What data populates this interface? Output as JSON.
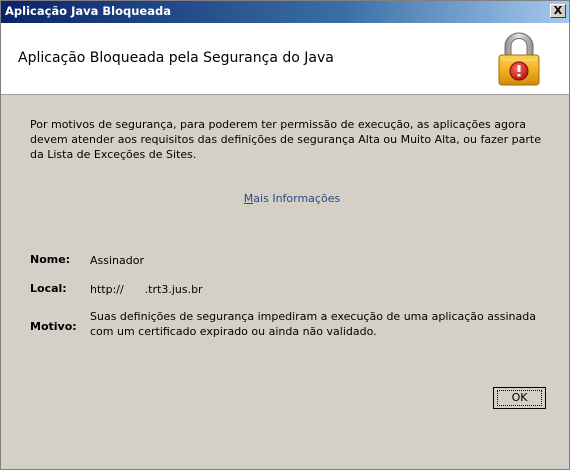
{
  "window": {
    "title": "Aplicação Java Bloqueada",
    "close_label": "X"
  },
  "header": {
    "title": "Aplicação Bloqueada pela Segurança do Java",
    "icon": "padlock-warning-icon",
    "icon_colors": {
      "shackle": "#a8a8a8",
      "body": "#f2b01e",
      "badge": "#d8201c"
    }
  },
  "message": "Por motivos de segurança, para poderem ter permissão de execução, as aplicações agora devem atender aos requisitos das definições de segurança Alta ou Muito Alta, ou fazer parte da Lista de Exceções de Sites.",
  "more_info": {
    "accel": "M",
    "rest": "ais Informações"
  },
  "fields": {
    "name": {
      "label": "Nome:",
      "value": "Assinador"
    },
    "location": {
      "label": "Local:",
      "value": "http://      .trt3.jus.br"
    },
    "reason": {
      "label": "Motivo:",
      "value": "Suas definições de segurança impediram a execução de uma aplicação assinada com um certificado expirado ou ainda não validado."
    }
  },
  "buttons": {
    "ok_label": "OK"
  }
}
